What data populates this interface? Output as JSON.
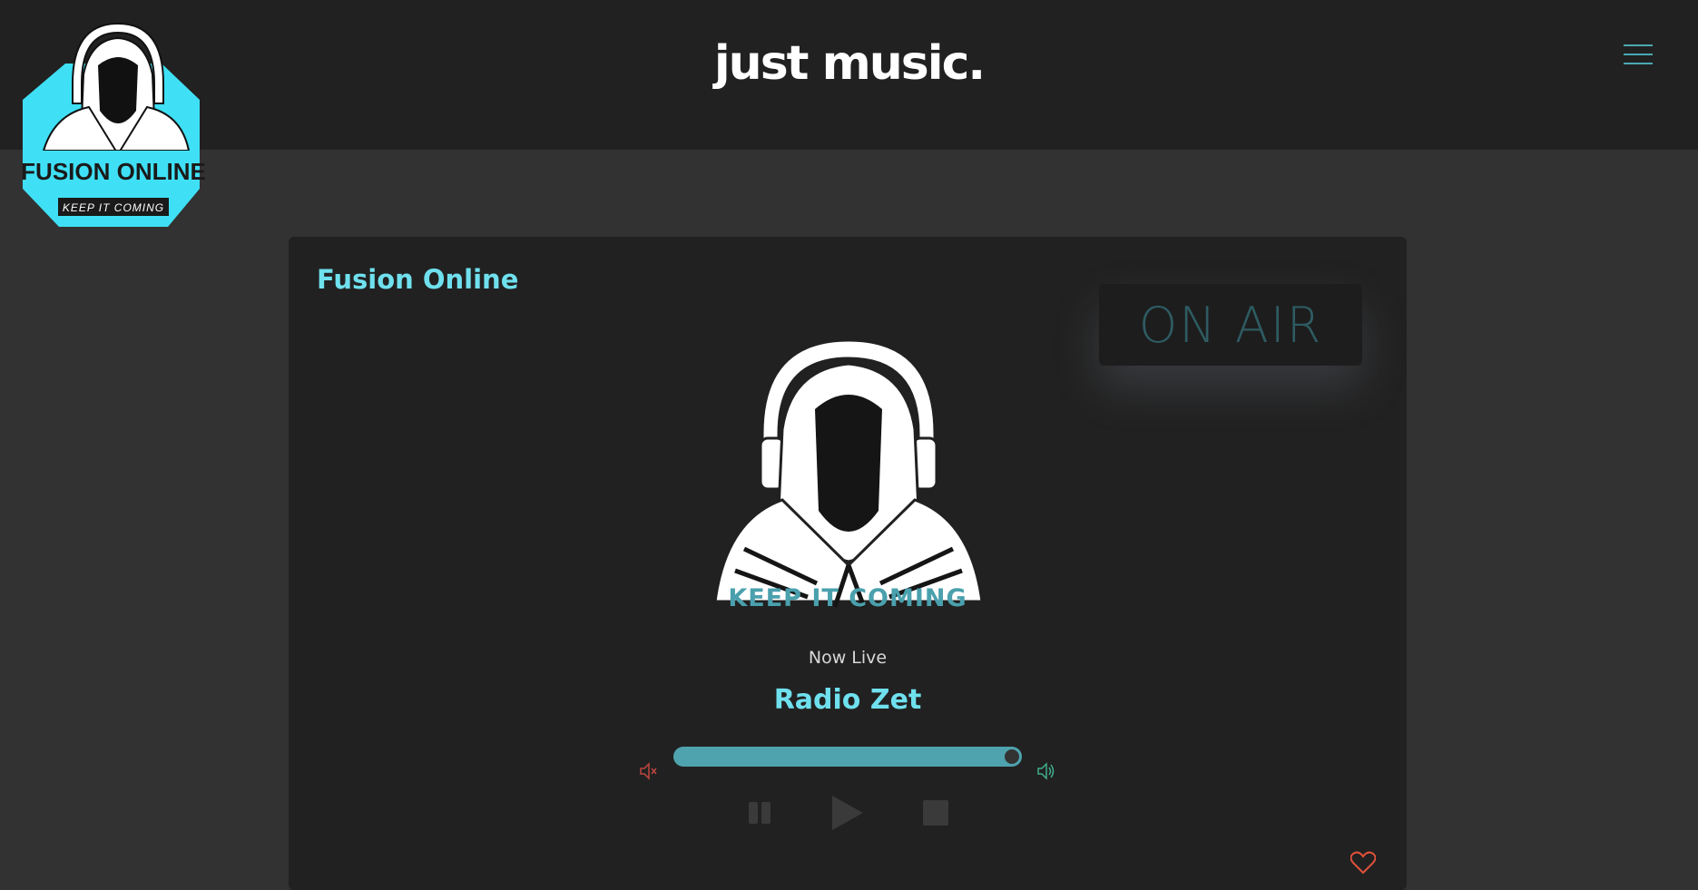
{
  "header": {
    "site_title": "just music.",
    "menu_icon": "hamburger-icon"
  },
  "logo": {
    "title": "FUSION ONLINE",
    "subtitle": "KEEP IT COMING",
    "accent_color": "#3fe0f5"
  },
  "player": {
    "station_name": "Fusion Online",
    "on_air_label": "ON AIR",
    "tagline": "KEEP IT COMING",
    "status": "Now Live",
    "track": "Radio Zet",
    "volume_percent": 100,
    "icons": {
      "mute": "volume-mute-icon",
      "volume": "volume-up-icon",
      "pause": "pause-icon",
      "play": "play-icon",
      "stop": "stop-icon",
      "favorite": "heart-icon"
    }
  },
  "colors": {
    "accent": "#6fe0ee",
    "slider": "#4ea3ae",
    "mute_icon": "#c0473e",
    "volume_icon": "#3fae8c",
    "heart": "#e2513b",
    "on_air_text": "#2e5b62"
  }
}
